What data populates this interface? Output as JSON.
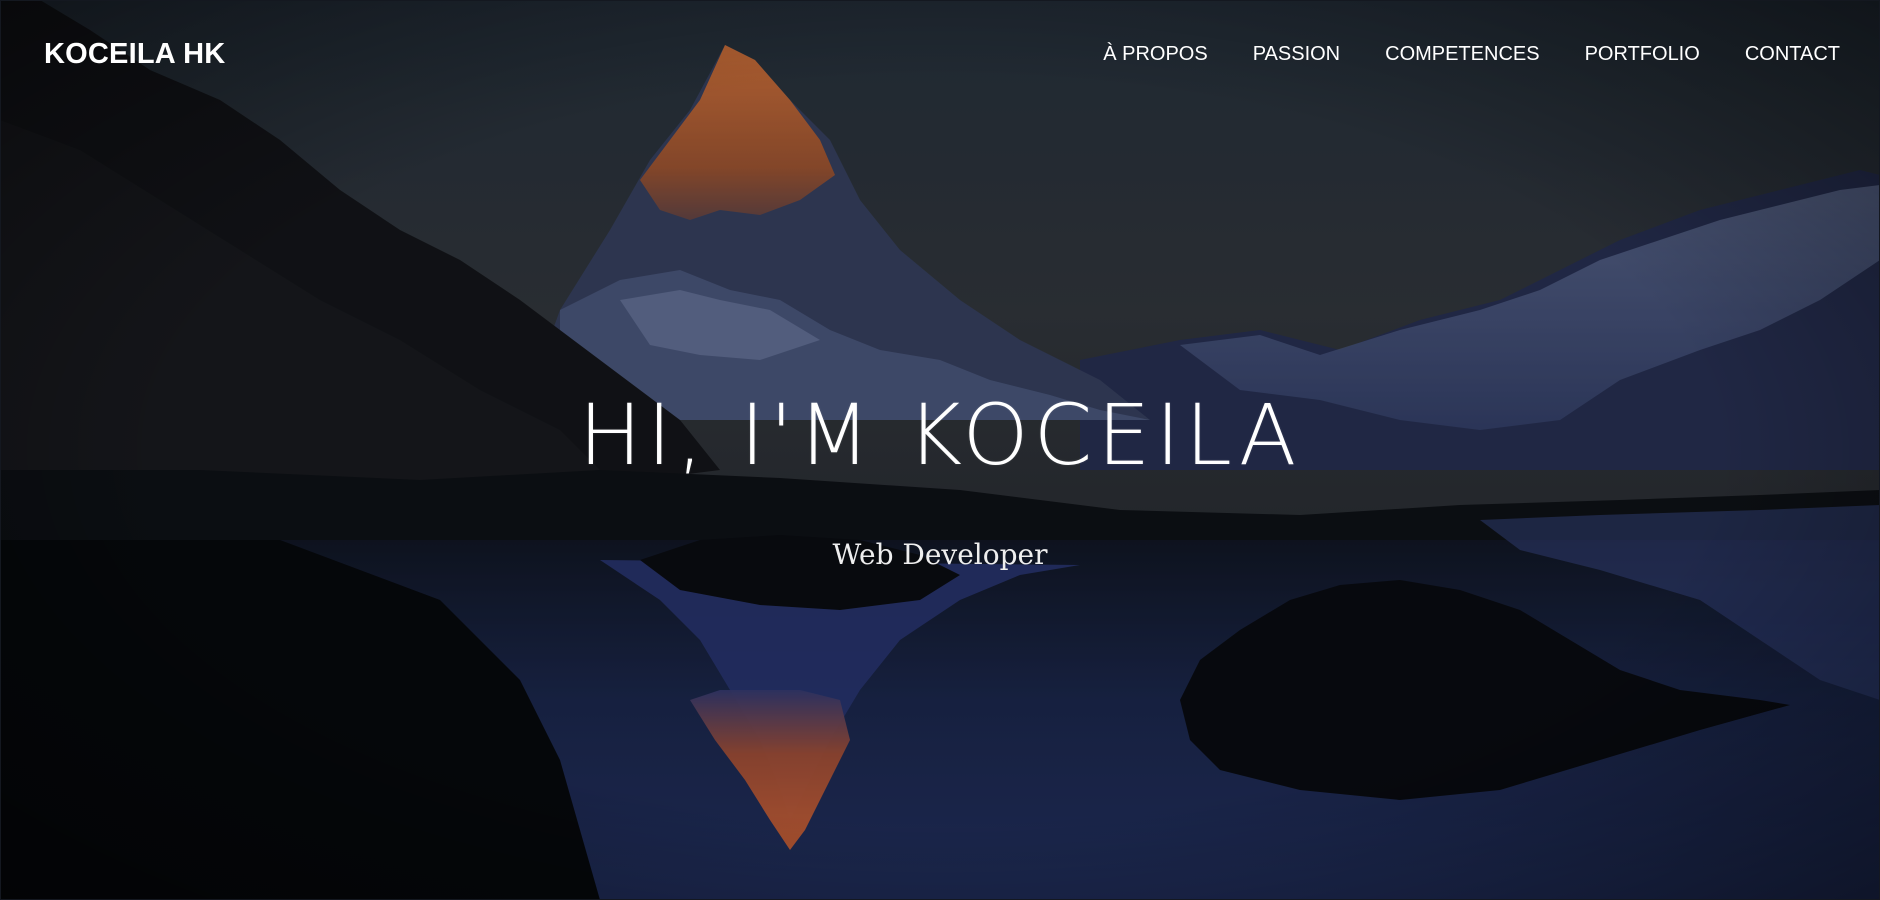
{
  "header": {
    "brand": "KOCEILA HK",
    "nav": [
      "À PROPOS",
      "PASSION",
      "COMPETENCES",
      "PORTFOLIO",
      "CONTACT"
    ]
  },
  "hero": {
    "title": "HI, I'M KOCEILA",
    "subtitle": "Web Developer"
  },
  "colors": {
    "text": "#ffffff",
    "peak_glow": "#d9703a",
    "water": "#2a3a7a"
  }
}
